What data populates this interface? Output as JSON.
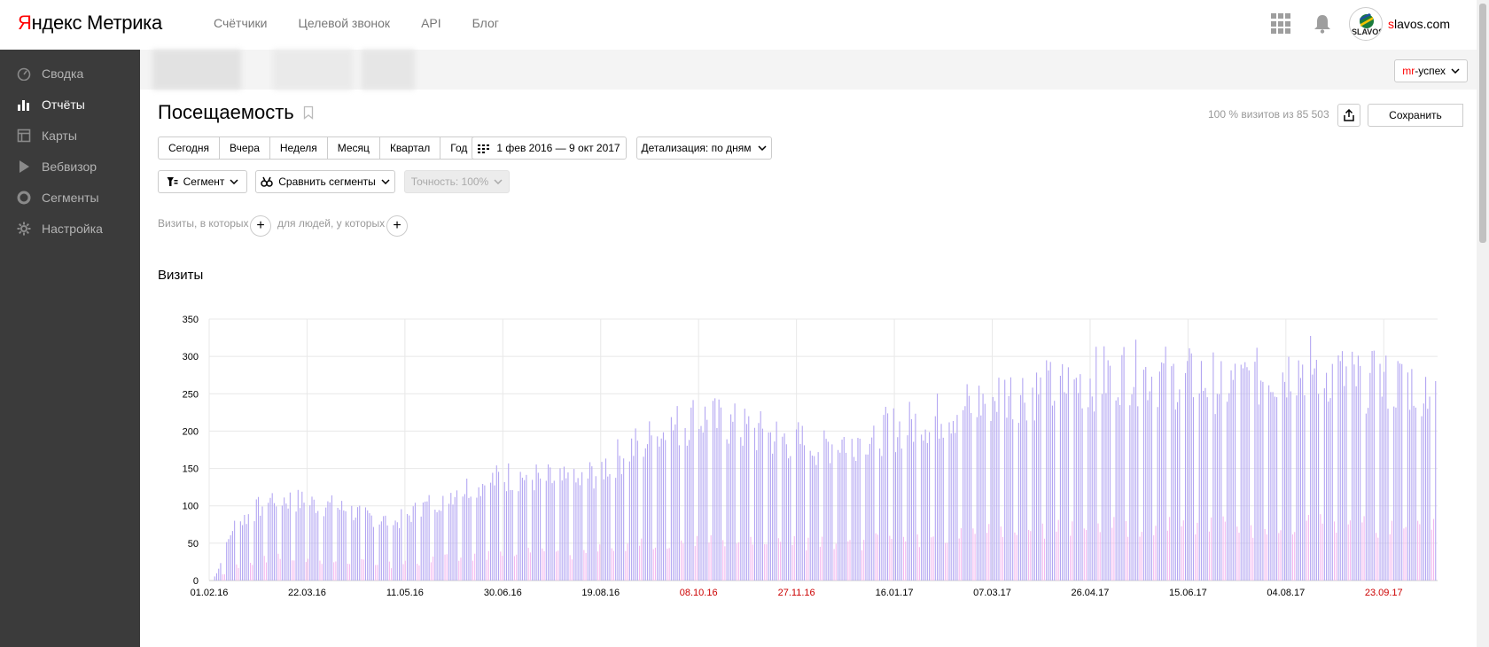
{
  "header": {
    "logo_y": "Я",
    "logo_rest": "ндекс Метрика",
    "nav": [
      "Счётчики",
      "Целевой звонок",
      "API",
      "Блог"
    ],
    "site_first": "s",
    "site_rest": "lavos.com",
    "avatar_text": "SLAVOS"
  },
  "sidebar": {
    "items": [
      {
        "label": "Сводка",
        "icon": "gauge-icon",
        "active": false
      },
      {
        "label": "Отчёты",
        "icon": "bar-chart-icon",
        "active": true
      },
      {
        "label": "Карты",
        "icon": "map-icon",
        "active": false
      },
      {
        "label": "Вебвизор",
        "icon": "play-icon",
        "active": false
      },
      {
        "label": "Сегменты",
        "icon": "pie-icon",
        "active": false
      },
      {
        "label": "Настройка",
        "icon": "gear-icon",
        "active": false
      }
    ]
  },
  "counter": {
    "goal_m": "mr",
    "goal_rest": "-успех"
  },
  "report": {
    "title": "Посещаемость",
    "share": "100 % визитов из 85 503",
    "save_label": "Сохранить",
    "periods": [
      "Сегодня",
      "Вчера",
      "Неделя",
      "Месяц",
      "Квартал",
      "Год"
    ],
    "date_range": "1 фев 2016 — 9 окт 2017",
    "detail": "Детализация: по дням",
    "segment": "Сегмент",
    "compare": "Сравнить сегменты",
    "accuracy": "Точность: 100%",
    "cond_visits": "Визиты, в которых",
    "cond_people": "для людей, у которых",
    "chart_title": "Визиты"
  },
  "chart_data": {
    "type": "bar",
    "title": "Визиты",
    "x_start": "01.02.16",
    "x_end": "09.10.17",
    "ylim": [
      0,
      350
    ],
    "yticks": [
      0,
      50,
      100,
      150,
      200,
      250,
      300,
      350
    ],
    "xticks": [
      {
        "label": "01.02.16",
        "weekend": false
      },
      {
        "label": "22.03.16",
        "weekend": false
      },
      {
        "label": "11.05.16",
        "weekend": false
      },
      {
        "label": "30.06.16",
        "weekend": false
      },
      {
        "label": "19.08.16",
        "weekend": false
      },
      {
        "label": "08.10.16",
        "weekend": true
      },
      {
        "label": "27.11.16",
        "weekend": true
      },
      {
        "label": "16.01.17",
        "weekend": false
      },
      {
        "label": "07.03.17",
        "weekend": false
      },
      {
        "label": "26.04.17",
        "weekend": false
      },
      {
        "label": "15.06.17",
        "weekend": false
      },
      {
        "label": "04.08.17",
        "weekend": false
      },
      {
        "label": "23.09.17",
        "weekend": true
      }
    ],
    "weekday_color": "#b3a6f2",
    "weekend_color": "#f3b8f0",
    "grid": true,
    "series_approx_monthly_peak": [
      {
        "period": "02.16",
        "weekday_peak": 60
      },
      {
        "period": "03.16",
        "weekday_peak": 130
      },
      {
        "period": "04.16",
        "weekday_peak": 115
      },
      {
        "period": "05.16",
        "weekday_peak": 90
      },
      {
        "period": "06.16",
        "weekday_peak": 140
      },
      {
        "period": "07.16",
        "weekday_peak": 165
      },
      {
        "period": "08.16",
        "weekday_peak": 150
      },
      {
        "period": "09.16",
        "weekday_peak": 210
      },
      {
        "period": "10.16",
        "weekday_peak": 255
      },
      {
        "period": "11.16",
        "weekday_peak": 230
      },
      {
        "period": "12.16",
        "weekday_peak": 210
      },
      {
        "period": "01.17",
        "weekday_peak": 230
      },
      {
        "period": "02.17",
        "weekday_peak": 255
      },
      {
        "period": "03.17",
        "weekday_peak": 290
      },
      {
        "period": "04.17",
        "weekday_peak": 300
      },
      {
        "period": "05.17",
        "weekday_peak": 325
      },
      {
        "period": "06.17",
        "weekday_peak": 315
      },
      {
        "period": "07.17",
        "weekday_peak": 305
      },
      {
        "period": "08.17",
        "weekday_peak": 335
      },
      {
        "period": "09.17",
        "weekday_peak": 310
      },
      {
        "period": "10.17",
        "weekday_peak": 305
      }
    ]
  }
}
